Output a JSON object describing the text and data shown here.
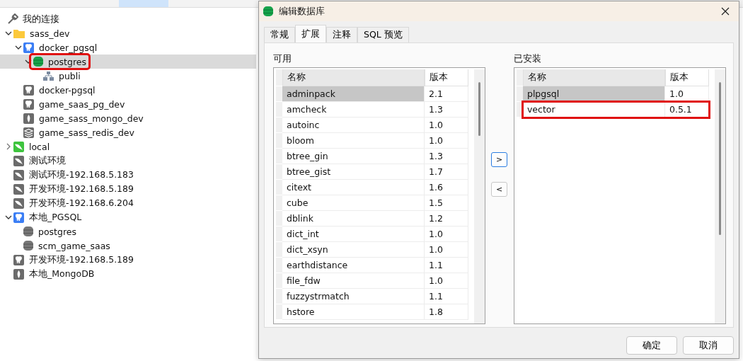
{
  "connections": {
    "title": "我的连接",
    "items": [
      {
        "label": "sass_dev",
        "kind": "folder",
        "expanded": true,
        "selected": false,
        "highlighted": false,
        "children": [
          {
            "label": "docker_pgsql",
            "kind": "postgres",
            "active": true,
            "expanded": true,
            "selected": false,
            "highlighted": false,
            "children": [
              {
                "label": "postgres",
                "kind": "database",
                "active": true,
                "expanded": true,
                "selected": true,
                "highlighted": true,
                "children": [
                  {
                    "label": "publi",
                    "kind": "schema",
                    "selected": false,
                    "highlighted": false
                  }
                ]
              }
            ]
          },
          {
            "label": "docker-pgsql",
            "kind": "postgres",
            "active": false,
            "selected": false,
            "highlighted": false
          },
          {
            "label": "game_saas_pg_dev",
            "kind": "postgres",
            "active": false,
            "selected": false,
            "highlighted": false
          },
          {
            "label": "game_sass_mongo_dev",
            "kind": "mongo",
            "active": false,
            "selected": false,
            "highlighted": false
          },
          {
            "label": "game_sass_redis_dev",
            "kind": "redis",
            "active": false,
            "selected": false,
            "highlighted": false
          }
        ]
      },
      {
        "label": "local",
        "kind": "mysql",
        "active": true,
        "expanded": false,
        "selected": false,
        "highlighted": false
      },
      {
        "label": "测试环境",
        "kind": "mysql",
        "active": false,
        "selected": false,
        "highlighted": false
      },
      {
        "label": "测试环境-192.168.5.183",
        "kind": "mysql",
        "active": false,
        "selected": false,
        "highlighted": false
      },
      {
        "label": "开发环境-192.168.5.189",
        "kind": "mysql",
        "active": false,
        "selected": false,
        "highlighted": false
      },
      {
        "label": "开发环境-192.168.6.204",
        "kind": "mysql",
        "active": false,
        "selected": false,
        "highlighted": false
      },
      {
        "label": "本地_PGSQL",
        "kind": "postgres",
        "active": true,
        "expanded": true,
        "selected": false,
        "highlighted": false,
        "children": [
          {
            "label": "postgres",
            "kind": "database",
            "active": false,
            "selected": false,
            "highlighted": false
          },
          {
            "label": "scm_game_saas",
            "kind": "database",
            "active": false,
            "selected": false,
            "highlighted": false
          }
        ]
      },
      {
        "label": "开发环境-192.168.5.189",
        "kind": "postgres",
        "active": false,
        "selected": false,
        "highlighted": false
      },
      {
        "label": "本地_MongoDB",
        "kind": "mongo",
        "active": false,
        "selected": false,
        "highlighted": false
      }
    ]
  },
  "dialog": {
    "title": "编辑数据库",
    "tabs": [
      {
        "label": "常规",
        "selected": false
      },
      {
        "label": "扩展",
        "selected": true
      },
      {
        "label": "注释",
        "selected": false
      },
      {
        "label": "SQL 预览",
        "selected": false
      }
    ],
    "available": {
      "label": "可用",
      "columns": [
        "名称",
        "版本"
      ],
      "rows": [
        {
          "name": "adminpack",
          "version": "2.1",
          "selected": true,
          "highlighted": false
        },
        {
          "name": "amcheck",
          "version": "1.3",
          "selected": false,
          "highlighted": false
        },
        {
          "name": "autoinc",
          "version": "1.0",
          "selected": false,
          "highlighted": false
        },
        {
          "name": "bloom",
          "version": "1.0",
          "selected": false,
          "highlighted": false
        },
        {
          "name": "btree_gin",
          "version": "1.3",
          "selected": false,
          "highlighted": false
        },
        {
          "name": "btree_gist",
          "version": "1.7",
          "selected": false,
          "highlighted": false
        },
        {
          "name": "citext",
          "version": "1.6",
          "selected": false,
          "highlighted": false
        },
        {
          "name": "cube",
          "version": "1.5",
          "selected": false,
          "highlighted": false
        },
        {
          "name": "dblink",
          "version": "1.2",
          "selected": false,
          "highlighted": false
        },
        {
          "name": "dict_int",
          "version": "1.0",
          "selected": false,
          "highlighted": false
        },
        {
          "name": "dict_xsyn",
          "version": "1.0",
          "selected": false,
          "highlighted": false
        },
        {
          "name": "earthdistance",
          "version": "1.1",
          "selected": false,
          "highlighted": false
        },
        {
          "name": "file_fdw",
          "version": "1.0",
          "selected": false,
          "highlighted": false
        },
        {
          "name": "fuzzystrmatch",
          "version": "1.1",
          "selected": false,
          "highlighted": false
        },
        {
          "name": "hstore",
          "version": "1.8",
          "selected": false,
          "highlighted": false
        }
      ]
    },
    "move_buttons": [
      ">",
      "<"
    ],
    "installed": {
      "label": "已安装",
      "columns": [
        "名称",
        "版本"
      ],
      "rows": [
        {
          "name": "plpgsql",
          "version": "1.0",
          "selected": true,
          "highlighted": false
        },
        {
          "name": "vector",
          "version": "0.5.1",
          "selected": false,
          "highlighted": true
        }
      ]
    },
    "buttons": [
      "确定",
      "取消"
    ]
  }
}
